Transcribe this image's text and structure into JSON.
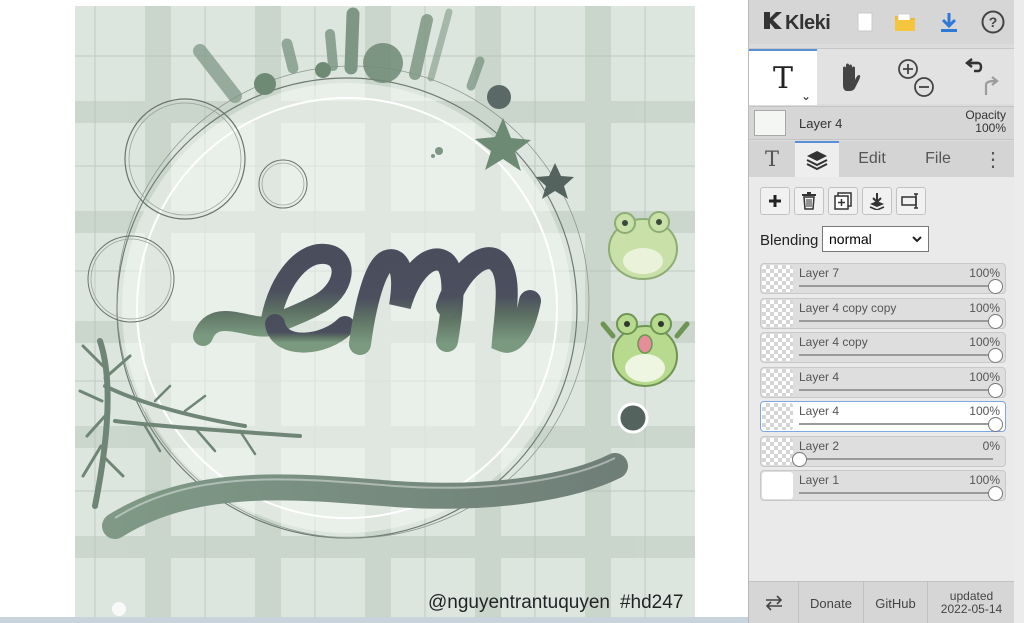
{
  "app": {
    "name": "Kleki",
    "colors": {
      "accent": "#5a8ed8",
      "panel": "#dcdcdc",
      "save_icon": "#f3b826",
      "download_icon": "#2f78d8"
    }
  },
  "topbar": {
    "icons": [
      "new-image-icon",
      "save-icon",
      "download-icon",
      "help-icon"
    ]
  },
  "toolbar": {
    "active_tool": "text-tool",
    "tools": [
      "text-tool",
      "hand-tool",
      "zoom-tool",
      "undo-redo"
    ]
  },
  "current_layer": {
    "name": "Layer 4",
    "opacity_label": "Opacity",
    "opacity_value": "100%"
  },
  "tabs": {
    "text": "T",
    "layers_icon": "layers-icon",
    "edit": "Edit",
    "file": "File",
    "more": "⋮"
  },
  "layers_panel": {
    "blending_label": "Blending",
    "blending_value": "normal",
    "buttons": [
      "add-layer-icon",
      "delete-layer-icon",
      "duplicate-layer-icon",
      "merge-down-icon",
      "rename-layer-icon"
    ],
    "layers": [
      {
        "name": "Layer 7",
        "opacity": "100%",
        "opacity_level": 1.0,
        "active": false,
        "thumb": "checker"
      },
      {
        "name": "Layer 4 copy copy",
        "opacity": "100%",
        "opacity_level": 1.0,
        "active": false,
        "thumb": "checker"
      },
      {
        "name": "Layer 4 copy",
        "opacity": "100%",
        "opacity_level": 1.0,
        "active": false,
        "thumb": "checker"
      },
      {
        "name": "Layer 4",
        "opacity": "100%",
        "opacity_level": 1.0,
        "active": false,
        "thumb": "checker"
      },
      {
        "name": "Layer 4",
        "opacity": "100%",
        "opacity_level": 1.0,
        "active": true,
        "thumb": "checker"
      },
      {
        "name": "Layer 2",
        "opacity": "0%",
        "opacity_level": 0.0,
        "active": false,
        "thumb": "checker"
      },
      {
        "name": "Layer 1",
        "opacity": "100%",
        "opacity_level": 1.0,
        "active": false,
        "thumb": "white"
      }
    ]
  },
  "footer": {
    "swap_icon": "swap-icon",
    "donate": "Donate",
    "github": "GitHub",
    "updated_label": "updated",
    "updated_date": "2022-05-14"
  },
  "canvas": {
    "credit_handle": "@nguyentrantuquyen",
    "credit_tag": "#hd247",
    "lettering": "em"
  }
}
